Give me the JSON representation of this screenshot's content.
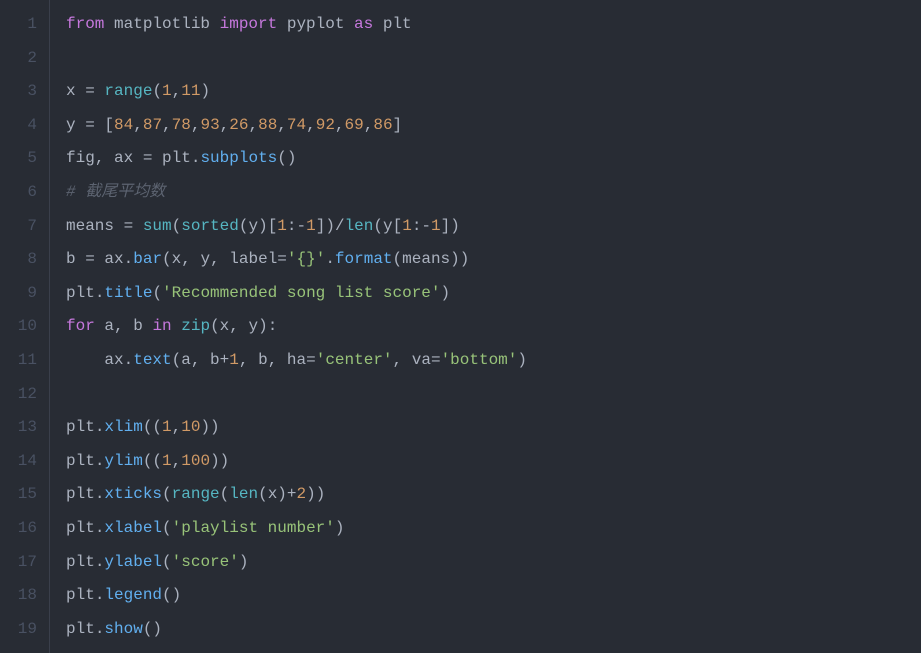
{
  "code": {
    "lines": [
      {
        "number": "1",
        "tokens": [
          {
            "t": "keyword",
            "v": "from"
          },
          {
            "t": "identifier",
            "v": " matplotlib "
          },
          {
            "t": "keyword",
            "v": "import"
          },
          {
            "t": "identifier",
            "v": " pyplot "
          },
          {
            "t": "keyword",
            "v": "as"
          },
          {
            "t": "identifier",
            "v": " plt"
          }
        ]
      },
      {
        "number": "2",
        "tokens": []
      },
      {
        "number": "3",
        "tokens": [
          {
            "t": "identifier",
            "v": "x "
          },
          {
            "t": "operator",
            "v": "="
          },
          {
            "t": "identifier",
            "v": " "
          },
          {
            "t": "builtin",
            "v": "range"
          },
          {
            "t": "paren",
            "v": "("
          },
          {
            "t": "number",
            "v": "1"
          },
          {
            "t": "punct",
            "v": ","
          },
          {
            "t": "number",
            "v": "11"
          },
          {
            "t": "paren",
            "v": ")"
          }
        ]
      },
      {
        "number": "4",
        "tokens": [
          {
            "t": "identifier",
            "v": "y "
          },
          {
            "t": "operator",
            "v": "="
          },
          {
            "t": "identifier",
            "v": " "
          },
          {
            "t": "paren",
            "v": "["
          },
          {
            "t": "number",
            "v": "84"
          },
          {
            "t": "punct",
            "v": ","
          },
          {
            "t": "number",
            "v": "87"
          },
          {
            "t": "punct",
            "v": ","
          },
          {
            "t": "number",
            "v": "78"
          },
          {
            "t": "punct",
            "v": ","
          },
          {
            "t": "number",
            "v": "93"
          },
          {
            "t": "punct",
            "v": ","
          },
          {
            "t": "number",
            "v": "26"
          },
          {
            "t": "punct",
            "v": ","
          },
          {
            "t": "number",
            "v": "88"
          },
          {
            "t": "punct",
            "v": ","
          },
          {
            "t": "number",
            "v": "74"
          },
          {
            "t": "punct",
            "v": ","
          },
          {
            "t": "number",
            "v": "92"
          },
          {
            "t": "punct",
            "v": ","
          },
          {
            "t": "number",
            "v": "69"
          },
          {
            "t": "punct",
            "v": ","
          },
          {
            "t": "number",
            "v": "86"
          },
          {
            "t": "paren",
            "v": "]"
          }
        ]
      },
      {
        "number": "5",
        "tokens": [
          {
            "t": "identifier",
            "v": "fig"
          },
          {
            "t": "punct",
            "v": ","
          },
          {
            "t": "identifier",
            "v": " ax "
          },
          {
            "t": "operator",
            "v": "="
          },
          {
            "t": "identifier",
            "v": " plt"
          },
          {
            "t": "punct",
            "v": "."
          },
          {
            "t": "func",
            "v": "subplots"
          },
          {
            "t": "paren",
            "v": "()"
          }
        ]
      },
      {
        "number": "6",
        "tokens": [
          {
            "t": "comment",
            "v": "# 截尾平均数"
          }
        ]
      },
      {
        "number": "7",
        "tokens": [
          {
            "t": "identifier",
            "v": "means "
          },
          {
            "t": "operator",
            "v": "="
          },
          {
            "t": "identifier",
            "v": " "
          },
          {
            "t": "builtin",
            "v": "sum"
          },
          {
            "t": "paren",
            "v": "("
          },
          {
            "t": "builtin",
            "v": "sorted"
          },
          {
            "t": "paren",
            "v": "("
          },
          {
            "t": "identifier",
            "v": "y"
          },
          {
            "t": "paren",
            "v": ")"
          },
          {
            "t": "paren",
            "v": "["
          },
          {
            "t": "number",
            "v": "1"
          },
          {
            "t": "punct",
            "v": ":"
          },
          {
            "t": "operator",
            "v": "-"
          },
          {
            "t": "number",
            "v": "1"
          },
          {
            "t": "paren",
            "v": "]"
          },
          {
            "t": "paren",
            "v": ")"
          },
          {
            "t": "operator",
            "v": "/"
          },
          {
            "t": "builtin",
            "v": "len"
          },
          {
            "t": "paren",
            "v": "("
          },
          {
            "t": "identifier",
            "v": "y"
          },
          {
            "t": "paren",
            "v": "["
          },
          {
            "t": "number",
            "v": "1"
          },
          {
            "t": "punct",
            "v": ":"
          },
          {
            "t": "operator",
            "v": "-"
          },
          {
            "t": "number",
            "v": "1"
          },
          {
            "t": "paren",
            "v": "]"
          },
          {
            "t": "paren",
            "v": ")"
          }
        ]
      },
      {
        "number": "8",
        "tokens": [
          {
            "t": "identifier",
            "v": "b "
          },
          {
            "t": "operator",
            "v": "="
          },
          {
            "t": "identifier",
            "v": " ax"
          },
          {
            "t": "punct",
            "v": "."
          },
          {
            "t": "func",
            "v": "bar"
          },
          {
            "t": "paren",
            "v": "("
          },
          {
            "t": "identifier",
            "v": "x"
          },
          {
            "t": "punct",
            "v": ","
          },
          {
            "t": "identifier",
            "v": " y"
          },
          {
            "t": "punct",
            "v": ","
          },
          {
            "t": "identifier",
            "v": " label"
          },
          {
            "t": "operator",
            "v": "="
          },
          {
            "t": "string",
            "v": "'{}'"
          },
          {
            "t": "punct",
            "v": "."
          },
          {
            "t": "func",
            "v": "format"
          },
          {
            "t": "paren",
            "v": "("
          },
          {
            "t": "identifier",
            "v": "means"
          },
          {
            "t": "paren",
            "v": ")"
          },
          {
            "t": "paren",
            "v": ")"
          }
        ]
      },
      {
        "number": "9",
        "tokens": [
          {
            "t": "identifier",
            "v": "plt"
          },
          {
            "t": "punct",
            "v": "."
          },
          {
            "t": "func",
            "v": "title"
          },
          {
            "t": "paren",
            "v": "("
          },
          {
            "t": "string",
            "v": "'Recommended song list score'"
          },
          {
            "t": "paren",
            "v": ")"
          }
        ]
      },
      {
        "number": "10",
        "tokens": [
          {
            "t": "keyword",
            "v": "for"
          },
          {
            "t": "identifier",
            "v": " a"
          },
          {
            "t": "punct",
            "v": ","
          },
          {
            "t": "identifier",
            "v": " b "
          },
          {
            "t": "keyword",
            "v": "in"
          },
          {
            "t": "identifier",
            "v": " "
          },
          {
            "t": "builtin",
            "v": "zip"
          },
          {
            "t": "paren",
            "v": "("
          },
          {
            "t": "identifier",
            "v": "x"
          },
          {
            "t": "punct",
            "v": ","
          },
          {
            "t": "identifier",
            "v": " y"
          },
          {
            "t": "paren",
            "v": ")"
          },
          {
            "t": "punct",
            "v": ":"
          }
        ]
      },
      {
        "number": "11",
        "tokens": [
          {
            "t": "identifier",
            "v": "    ax"
          },
          {
            "t": "punct",
            "v": "."
          },
          {
            "t": "func",
            "v": "text"
          },
          {
            "t": "paren",
            "v": "("
          },
          {
            "t": "identifier",
            "v": "a"
          },
          {
            "t": "punct",
            "v": ","
          },
          {
            "t": "identifier",
            "v": " b"
          },
          {
            "t": "operator",
            "v": "+"
          },
          {
            "t": "number",
            "v": "1"
          },
          {
            "t": "punct",
            "v": ","
          },
          {
            "t": "identifier",
            "v": " b"
          },
          {
            "t": "punct",
            "v": ","
          },
          {
            "t": "identifier",
            "v": " ha"
          },
          {
            "t": "operator",
            "v": "="
          },
          {
            "t": "string",
            "v": "'center'"
          },
          {
            "t": "punct",
            "v": ","
          },
          {
            "t": "identifier",
            "v": " va"
          },
          {
            "t": "operator",
            "v": "="
          },
          {
            "t": "string",
            "v": "'bottom'"
          },
          {
            "t": "paren",
            "v": ")"
          }
        ]
      },
      {
        "number": "12",
        "tokens": []
      },
      {
        "number": "13",
        "tokens": [
          {
            "t": "identifier",
            "v": "plt"
          },
          {
            "t": "punct",
            "v": "."
          },
          {
            "t": "func",
            "v": "xlim"
          },
          {
            "t": "paren",
            "v": "(("
          },
          {
            "t": "number",
            "v": "1"
          },
          {
            "t": "punct",
            "v": ","
          },
          {
            "t": "number",
            "v": "10"
          },
          {
            "t": "paren",
            "v": "))"
          }
        ]
      },
      {
        "number": "14",
        "tokens": [
          {
            "t": "identifier",
            "v": "plt"
          },
          {
            "t": "punct",
            "v": "."
          },
          {
            "t": "func",
            "v": "ylim"
          },
          {
            "t": "paren",
            "v": "(("
          },
          {
            "t": "number",
            "v": "1"
          },
          {
            "t": "punct",
            "v": ","
          },
          {
            "t": "number",
            "v": "100"
          },
          {
            "t": "paren",
            "v": "))"
          }
        ]
      },
      {
        "number": "15",
        "tokens": [
          {
            "t": "identifier",
            "v": "plt"
          },
          {
            "t": "punct",
            "v": "."
          },
          {
            "t": "func",
            "v": "xticks"
          },
          {
            "t": "paren",
            "v": "("
          },
          {
            "t": "builtin",
            "v": "range"
          },
          {
            "t": "paren",
            "v": "("
          },
          {
            "t": "builtin",
            "v": "len"
          },
          {
            "t": "paren",
            "v": "("
          },
          {
            "t": "identifier",
            "v": "x"
          },
          {
            "t": "paren",
            "v": ")"
          },
          {
            "t": "operator",
            "v": "+"
          },
          {
            "t": "number",
            "v": "2"
          },
          {
            "t": "paren",
            "v": "))"
          }
        ]
      },
      {
        "number": "16",
        "tokens": [
          {
            "t": "identifier",
            "v": "plt"
          },
          {
            "t": "punct",
            "v": "."
          },
          {
            "t": "func",
            "v": "xlabel"
          },
          {
            "t": "paren",
            "v": "("
          },
          {
            "t": "string",
            "v": "'playlist number'"
          },
          {
            "t": "paren",
            "v": ")"
          }
        ]
      },
      {
        "number": "17",
        "tokens": [
          {
            "t": "identifier",
            "v": "plt"
          },
          {
            "t": "punct",
            "v": "."
          },
          {
            "t": "func",
            "v": "ylabel"
          },
          {
            "t": "paren",
            "v": "("
          },
          {
            "t": "string",
            "v": "'score'"
          },
          {
            "t": "paren",
            "v": ")"
          }
        ]
      },
      {
        "number": "18",
        "tokens": [
          {
            "t": "identifier",
            "v": "plt"
          },
          {
            "t": "punct",
            "v": "."
          },
          {
            "t": "func",
            "v": "legend"
          },
          {
            "t": "paren",
            "v": "()"
          }
        ]
      },
      {
        "number": "19",
        "tokens": [
          {
            "t": "identifier",
            "v": "plt"
          },
          {
            "t": "punct",
            "v": "."
          },
          {
            "t": "func",
            "v": "show"
          },
          {
            "t": "paren",
            "v": "()"
          }
        ]
      }
    ]
  }
}
